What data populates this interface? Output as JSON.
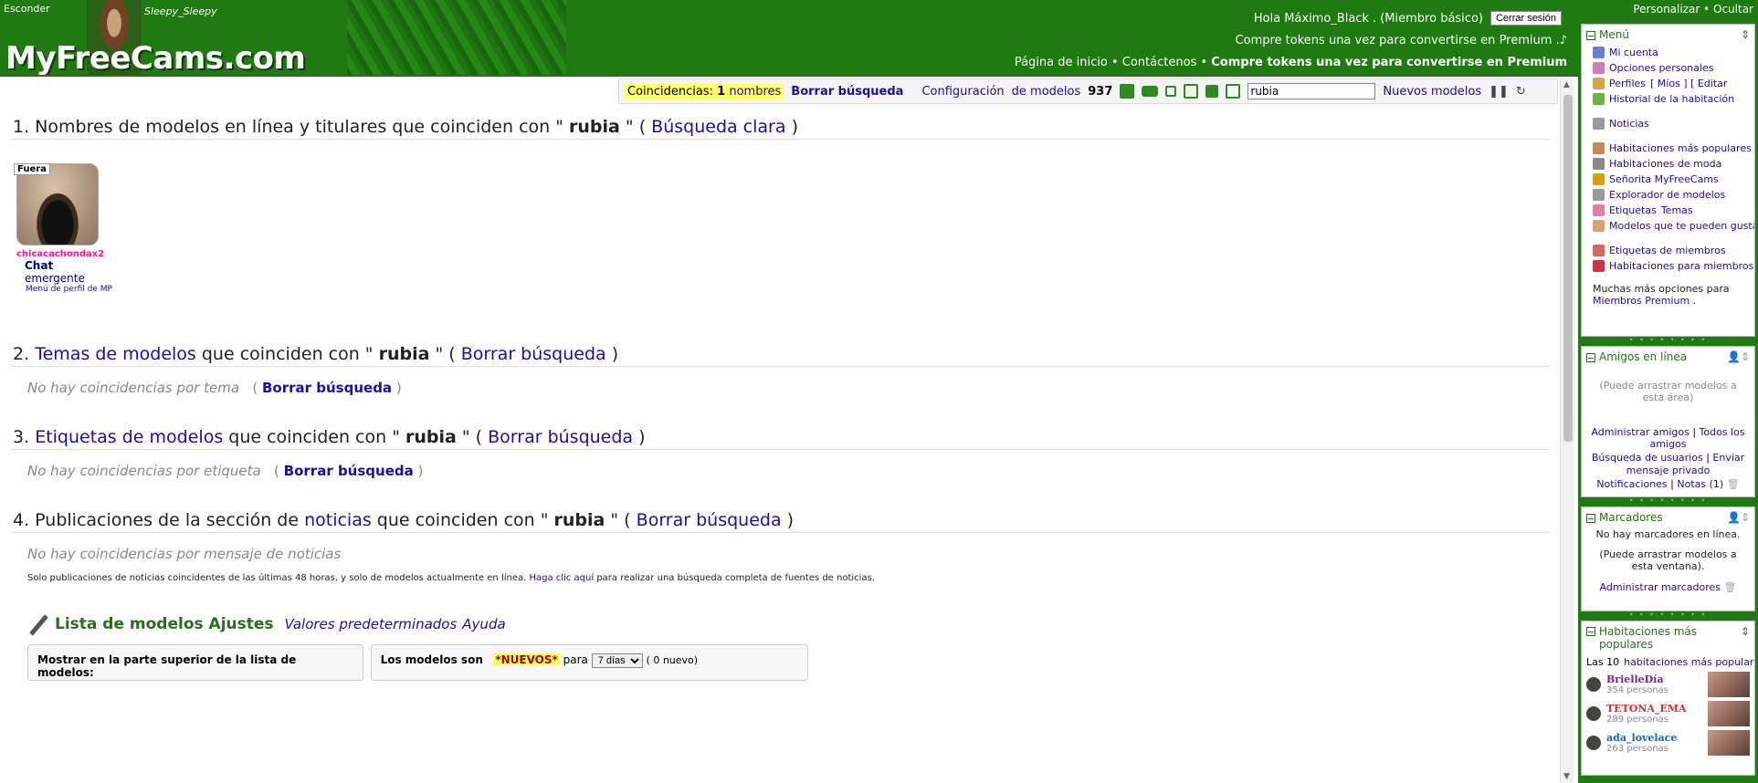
{
  "header": {
    "hide_link": "Esconder",
    "username": "Sleepy_Sleepy",
    "logo": "MyFreeCams.com",
    "hello": "Hola",
    "member_name": "Máximo_Black",
    "member_type": ". (Miembro básico)",
    "logout": "Cerrar sesión",
    "tokens_link": "Compre tokens",
    "tokens_text": "una vez para convertirse en",
    "premium_link": "Premium",
    "nav_page": "Página",
    "nav_home": "de inicio",
    "nav_contacts": "Contáctenos",
    "nav_buy": "Compre tokens una vez para convertirse en Premium"
  },
  "toolbar": {
    "matches_label": "Coincidencias:",
    "matches_count": "1",
    "matches_names": "nombres",
    "clear_search": "Borrar búsqueda",
    "config_link": "Configuración",
    "models_link": "de modelos",
    "count": "937",
    "search_value": "rubia",
    "new_models": "Nuevos modelos"
  },
  "main": {
    "sec1_prefix": "1. Nombres de modelos en línea y titulares que coinciden con \"",
    "term": "rubia",
    "sec1_suffix": "\" (",
    "sec1_link": "Búsqueda clara",
    "close_paren": ")",
    "model": {
      "status": "Fuera",
      "name": "chicacachondax2",
      "chat": "Chat",
      "emergent": "emergente",
      "profile_menu": "Menú de perfil de MP"
    },
    "sec2_prefix": "2.",
    "sec2_link": "Temas de modelos",
    "sec2_mid": "que coinciden con \"",
    "sec2_suffix": "\" (",
    "clear_link": "Borrar búsqueda",
    "no_topics": "No hay coincidencias por tema",
    "sec3_prefix": "3.",
    "sec3_link": "Etiquetas de modelos",
    "no_tags": "No hay coincidencias por etiqueta",
    "sec4_prefix": "4. Publicaciones de la sección de",
    "sec4_link": "noticias",
    "no_news": "No hay coincidencias por mensaje de noticias",
    "news_note_pre": "Solo publicaciones de noticias coincidentes de las últimas 48 horas, y solo de modelos actualmente en línea.",
    "news_note_link": "Haga clic aquí",
    "news_note_post": "para realizar una búsqueda completa de fuentes de noticias.",
    "settings_title": "Lista de modelos Ajustes",
    "settings_defaults": "Valores predeterminados",
    "settings_help": "Ayuda",
    "show_top": "Mostrar en la parte superior de la lista de modelos:",
    "models_are": "Los modelos son",
    "nuevos": "*NUEVOS*",
    "para": "para",
    "days": "7 días",
    "new_count": "( 0 nuevo)"
  },
  "sidebar": {
    "personalize": "Personalizar",
    "hide": "Ocultar",
    "menu_title": "Menú",
    "menu_items": [
      {
        "label": "Mi cuenta",
        "color": "#6a7fd0"
      },
      {
        "label": "Opciones personales",
        "color": "#c97fb3"
      },
      {
        "label": "Perfiles",
        "extra": "[ Míos ] [ Editar",
        "color": "#d9a34a"
      },
      {
        "label": "Historial de la habitación",
        "color": "#6fb04a"
      },
      {
        "label": "Noticias",
        "color": "#9a9a9a"
      },
      {
        "label": "Habitaciones más populares",
        "color": "#c08a5a"
      },
      {
        "label": "Habitaciones de moda",
        "color": "#888888"
      },
      {
        "label": "Señorita MyFreeCams",
        "color": "#d4a017"
      },
      {
        "label": "Explorador de modelos",
        "color": "#999999"
      },
      {
        "label": "Etiquetas",
        "extra": "Temas",
        "color": "#e07fa5"
      },
      {
        "label": "Modelos que te pueden gustar",
        "color": "#d9a070"
      },
      {
        "label": "Etiquetas de miembros",
        "color": "#d06a6a"
      },
      {
        "label": "Habitaciones para miembros",
        "color": "#cc3344"
      }
    ],
    "more_options": "Muchas más opciones para",
    "premium_members": "Miembros Premium",
    "friends_title": "Amigos en línea",
    "friends_note": "(Puede arrastrar modelos a esta área)",
    "manage_friends": "Administrar amigos",
    "all_friends": "Todos los amigos",
    "user_search": "Búsqueda de usuarios",
    "send_pm": "Enviar mensaje privado",
    "notifications": "Notificaciones",
    "notes": "Notas (1)",
    "bookmarks_title": "Marcadores",
    "no_bookmarks": "No hay marcadores en línea.",
    "bookmarks_note": "(Puede arrastrar modelos a esta ventana).",
    "manage_bookmarks": "Administrar marcadores",
    "popular_title": "Habitaciones más populares",
    "top10": "Las 10",
    "top10_link": "habitaciones más populares",
    "rooms": [
      {
        "name": "BrielleDía",
        "count": "354 personas",
        "color": "#7b1fa2"
      },
      {
        "name": "TETONA_EMA",
        "count": "289 personas",
        "color": "#d32f2f"
      },
      {
        "name": "ada_lovelace",
        "count": "263 personas",
        "color": "#1565c0"
      }
    ]
  }
}
